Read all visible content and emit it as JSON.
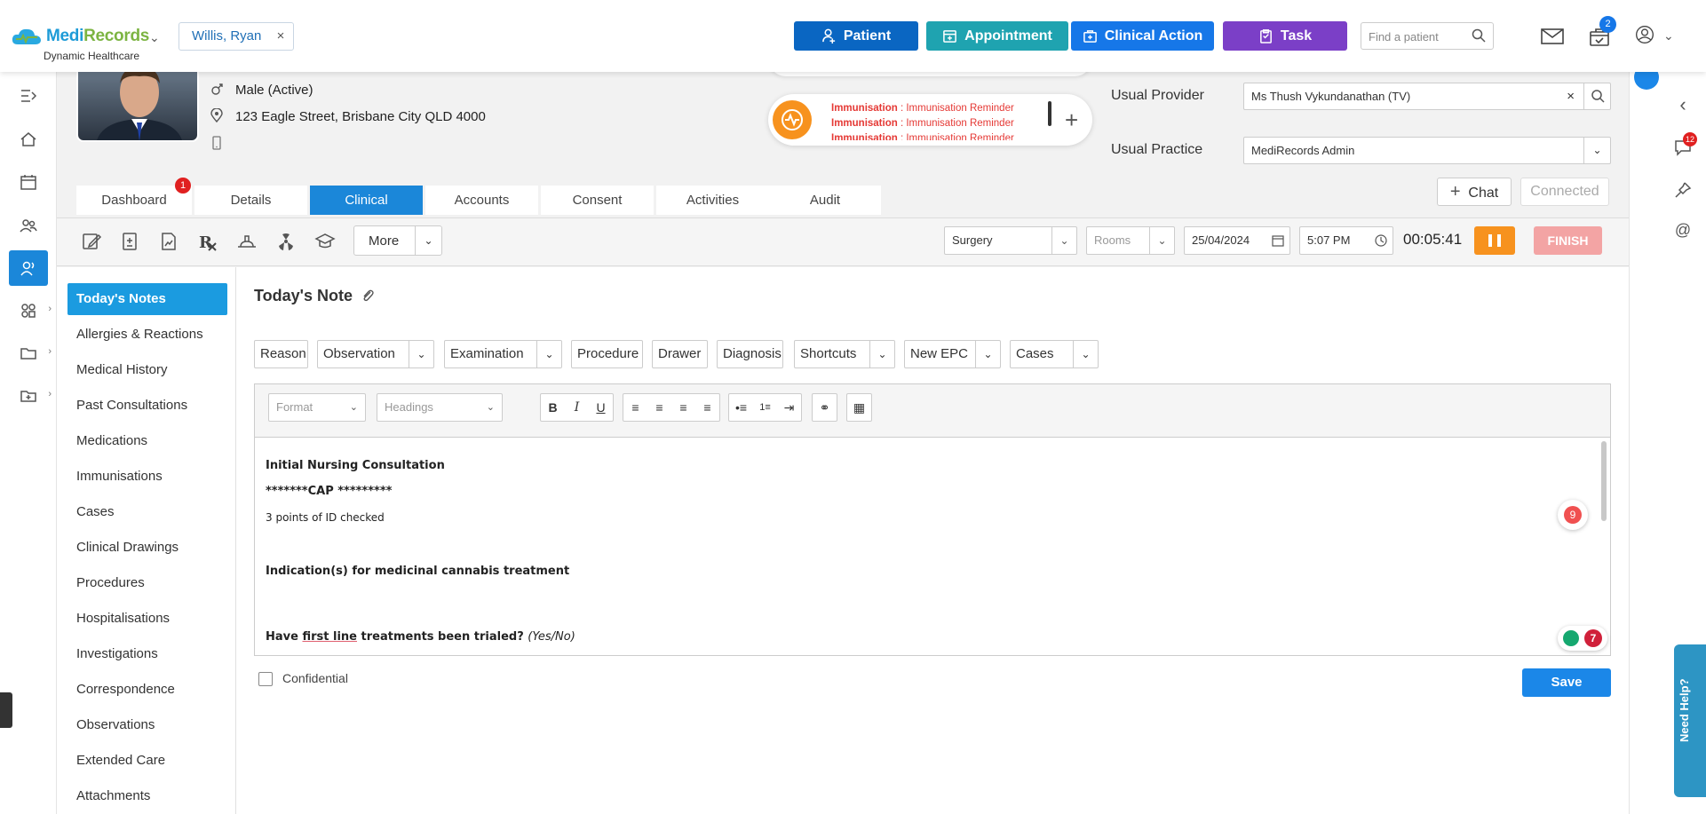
{
  "brand": {
    "name_a": "Medi",
    "name_b": "Records",
    "subtitle": "Dynamic Healthcare"
  },
  "patient_tag": {
    "name": "Willis, Ryan",
    "close": "×"
  },
  "top_actions": [
    {
      "label": "Patient",
      "color": "#0a66c2"
    },
    {
      "label": "Appointment",
      "color": "#1fa3b0"
    },
    {
      "label": "Clinical Action",
      "color": "#1677e8"
    },
    {
      "label": "Task",
      "color": "#7b3fc7"
    }
  ],
  "search": {
    "placeholder": "Find a patient"
  },
  "cart_badge": "2",
  "patient": {
    "gender": "Male (Active)",
    "address": "123 Eagle Street, Brisbane City QLD 4000"
  },
  "reminders": [
    {
      "type": "Immunisation",
      "text": ": Immunisation Reminder"
    },
    {
      "type": "Immunisation",
      "text": ": Immunisation Reminder"
    },
    {
      "type": "Immunisation",
      "text": ": Immunisation Reminder"
    }
  ],
  "usual_provider": {
    "label": "Usual Provider",
    "value": "Ms Thush Vykundanathan (TV)"
  },
  "usual_practice": {
    "label": "Usual Practice",
    "value": "MediRecords Admin"
  },
  "tabs": [
    "Dashboard",
    "Details",
    "Clinical",
    "Accounts",
    "Consent",
    "Activities",
    "Audit"
  ],
  "dashboard_badge": "1",
  "chat": {
    "label": "Chat",
    "connected": "Connected"
  },
  "toolbar": {
    "more": "More",
    "location": "Surgery",
    "rooms_placeholder": "Rooms",
    "date": "25/04/2024",
    "time": "5:07 PM",
    "timer": "00:05:41",
    "finish": "FINISH"
  },
  "sidenav": [
    "Today's Notes",
    "Allergies & Reactions",
    "Medical History",
    "Past Consultations",
    "Medications",
    "Immunisations",
    "Cases",
    "Clinical Drawings",
    "Procedures",
    "Hospitalisations",
    "Investigations",
    "Correspondence",
    "Observations",
    "Extended Care",
    "Attachments"
  ],
  "note": {
    "title": "Today's Note",
    "buttons": [
      "Reason",
      "Observation",
      "Examination",
      "Procedure",
      "Drawer",
      "Diagnosis",
      "Shortcuts",
      "New EPC",
      "Cases"
    ],
    "format_placeholder": "Format",
    "headings_placeholder": "Headings",
    "lines": {
      "l1": "Initial Nursing Consultation",
      "l2": "*******CAP *********",
      "l3": "3 points of ID checked",
      "l4": "Indication(s) for medicinal cannabis treatment",
      "l5a": "Have ",
      "l5b": "first line",
      "l5c": " treatments been trialed? ",
      "l5d": "(Yes/No)"
    },
    "badge_9": "9",
    "badge_7": "7",
    "confidential": "Confidential",
    "save": "Save"
  },
  "right_rail": {
    "chat_badge": "12",
    "help": "Need Help?"
  }
}
